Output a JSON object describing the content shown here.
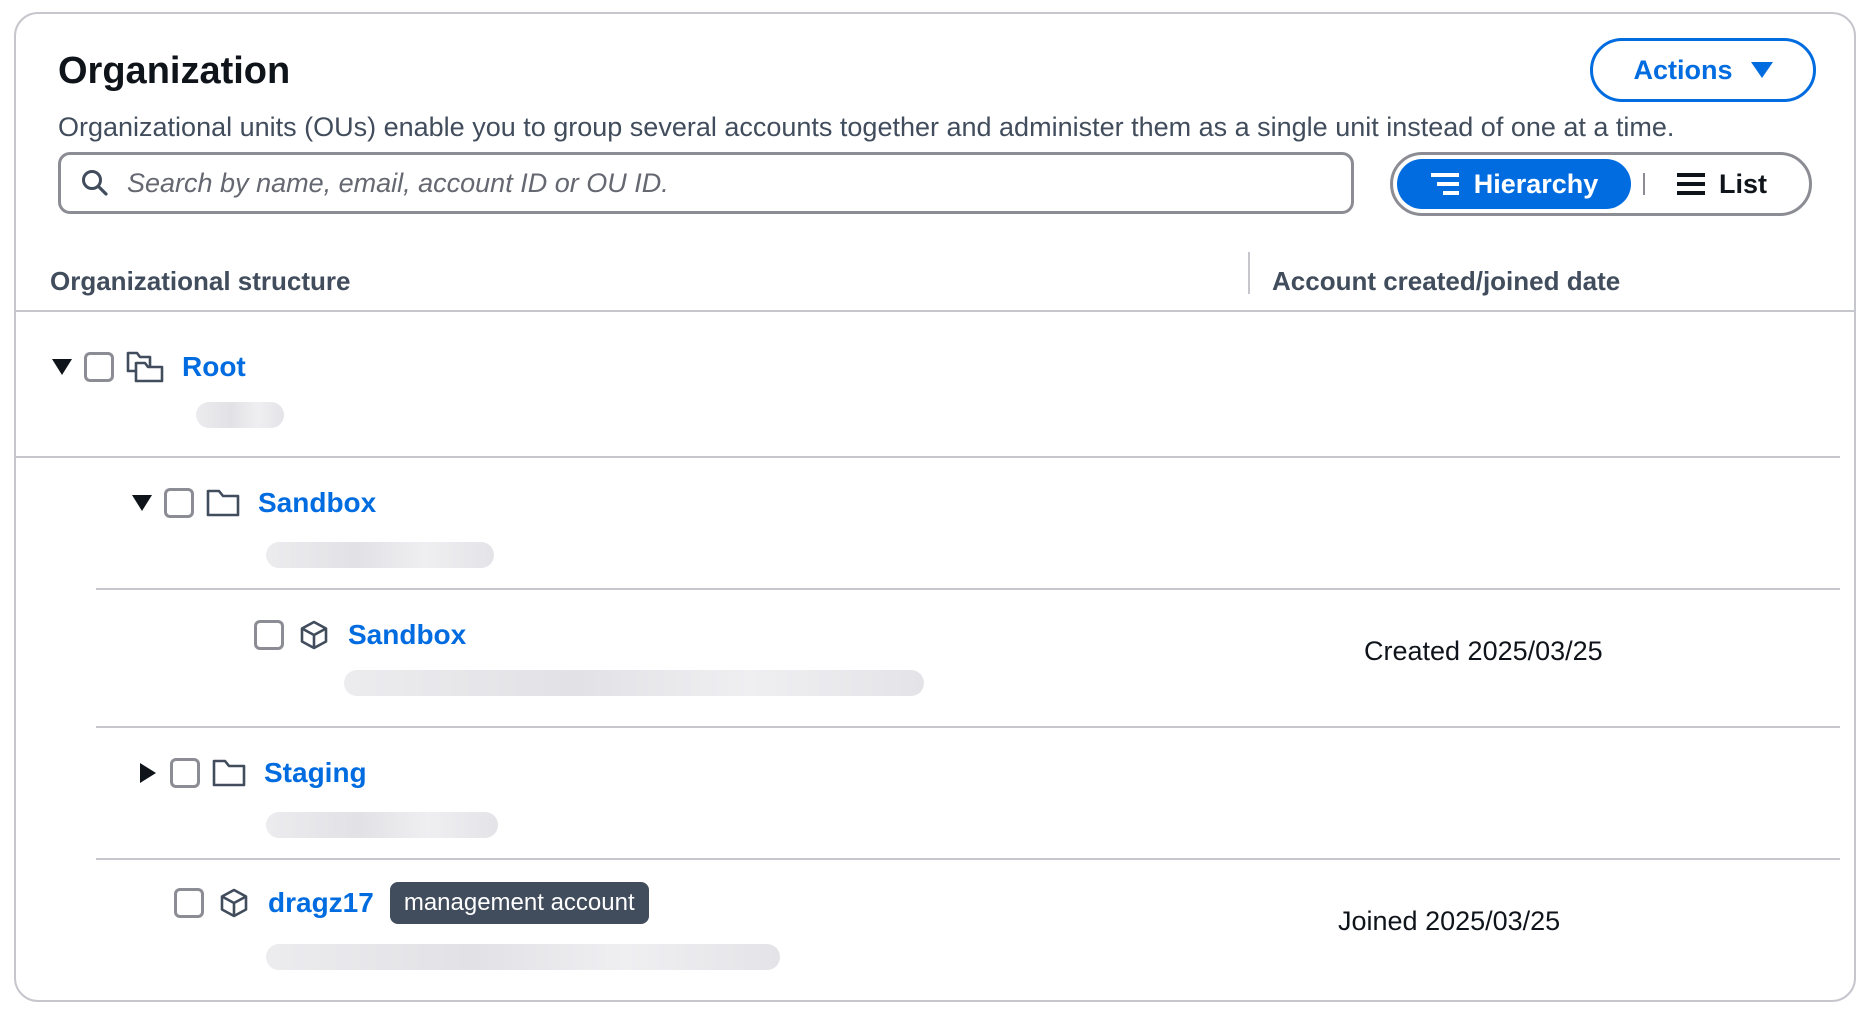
{
  "header": {
    "title": "Organization",
    "description": "Organizational units (OUs) enable you to group several accounts together and administer them as a single unit instead of one at a time.",
    "actions_label": "Actions"
  },
  "search": {
    "placeholder": "Search by name, email, account ID or OU ID."
  },
  "view_toggle": {
    "hierarchy_label": "Hierarchy",
    "list_label": "List",
    "selected": "Hierarchy"
  },
  "table": {
    "columns": [
      "Organizational structure",
      "Account created/joined date"
    ],
    "rows": [
      {
        "type": "root",
        "name": "Root",
        "expanded": true,
        "date": ""
      },
      {
        "type": "ou",
        "name": "Sandbox",
        "expanded": true,
        "date": ""
      },
      {
        "type": "account",
        "name": "Sandbox",
        "date": "Created 2025/03/25"
      },
      {
        "type": "ou",
        "name": "Staging",
        "expanded": false,
        "date": ""
      },
      {
        "type": "account",
        "name": "dragz17",
        "badge": "management account",
        "date": "Joined 2025/03/25"
      }
    ]
  },
  "colors": {
    "accent": "#006ce0",
    "badge_bg": "#414d5c",
    "border": "#c6c6cd"
  }
}
